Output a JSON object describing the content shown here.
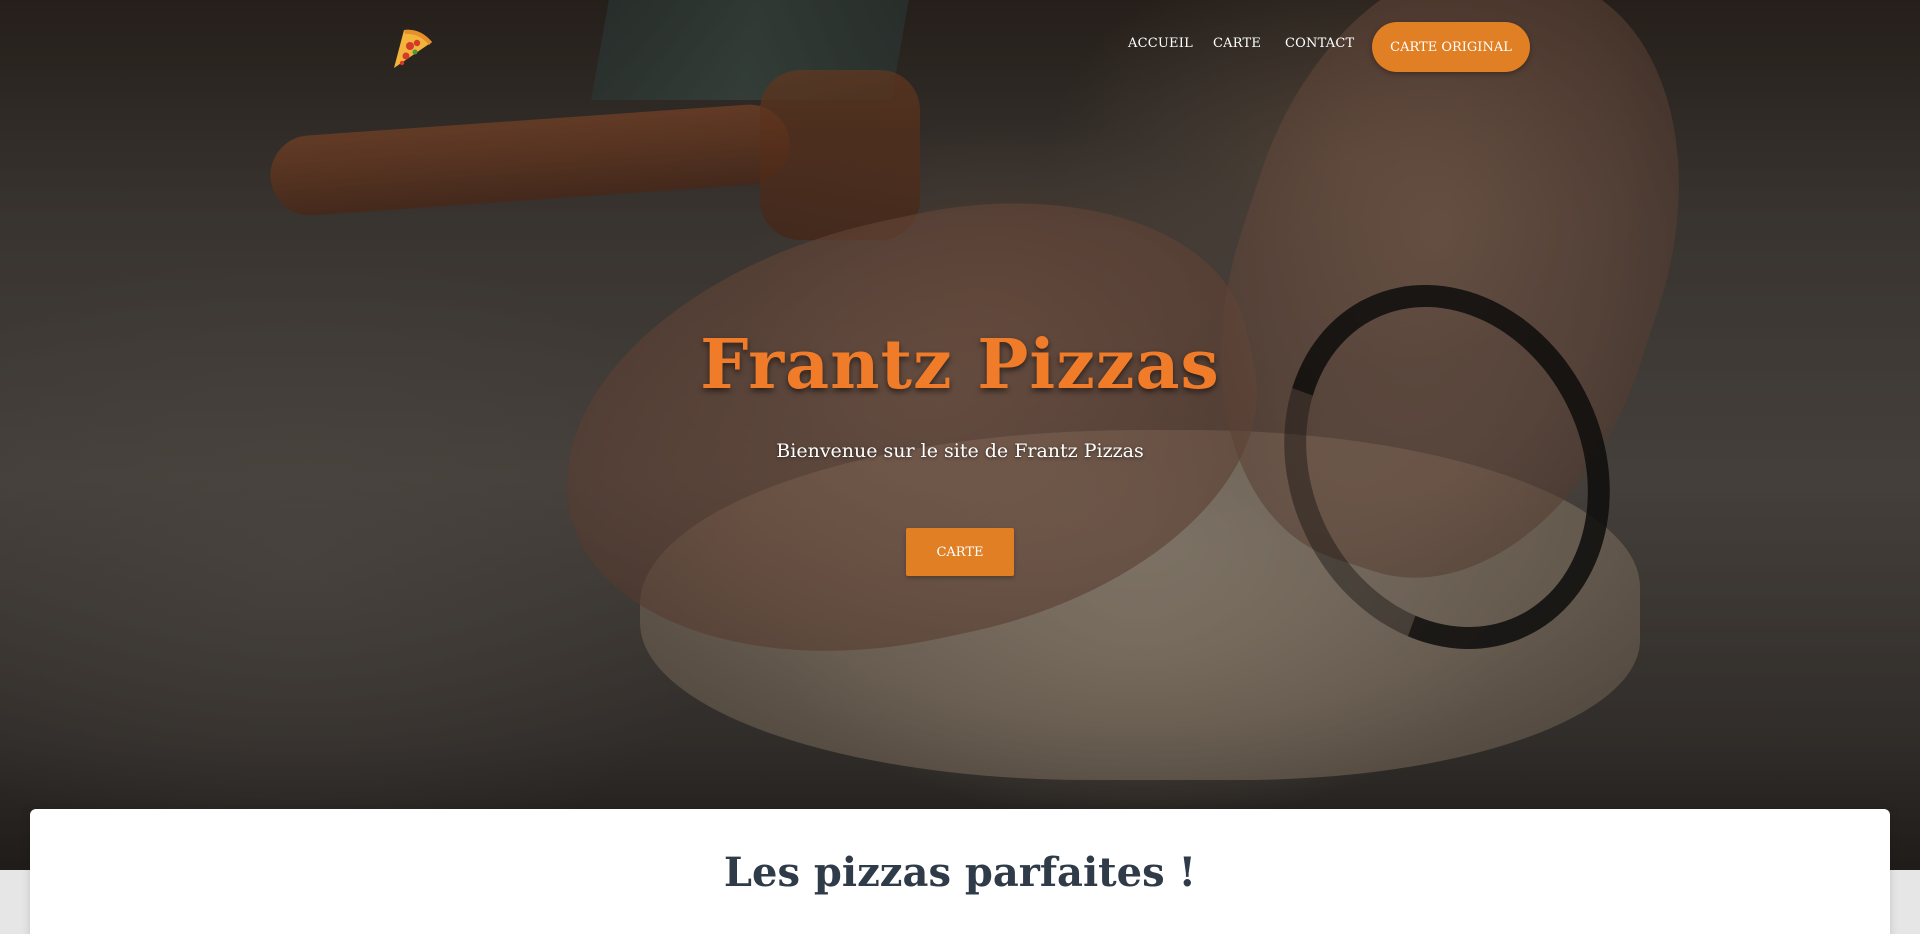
{
  "nav": {
    "logo_icon": "pizza-slice-icon",
    "links": [
      {
        "label": "ACCUEIL"
      },
      {
        "label": "CARTE"
      },
      {
        "label": "CONTACT"
      }
    ],
    "cta_label": "CARTE ORIGINAL"
  },
  "hero": {
    "title": "Frantz Pizzas",
    "subtitle": "Bienvenue sur le site de Frantz Pizzas",
    "button_label": "CARTE",
    "background_image": "hands-kneading-dough-photo"
  },
  "section": {
    "title": "Les pizzas parfaites !"
  },
  "colors": {
    "accent": "#e07f24",
    "title_orange": "#f07c2a",
    "heading_dark": "#2f3b48"
  }
}
